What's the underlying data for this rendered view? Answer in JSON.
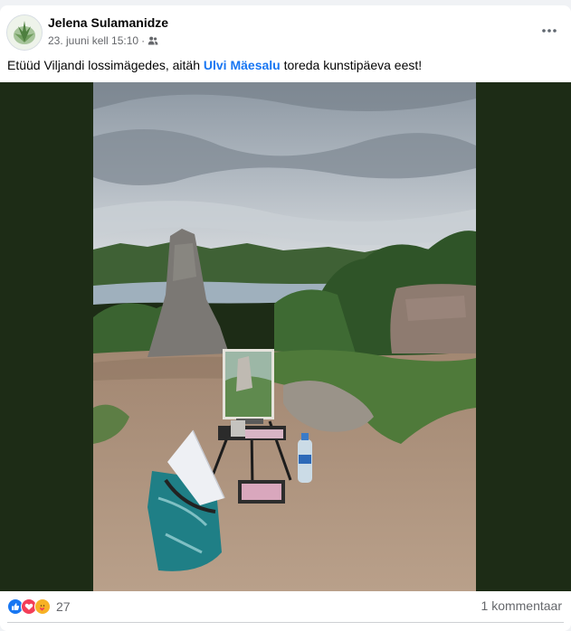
{
  "post": {
    "author": "Jelena Sulamanidze",
    "date": "23. juuni kell 15:10",
    "separator": "·",
    "audience_icon": "friends-icon",
    "caption_before": "Etüüd Viljandi lossimägedes, aitäh ",
    "caption_mention": "Ulvi Mäesalu",
    "caption_after": " toreda kunstipäeva eest!"
  },
  "footer": {
    "reactions": [
      "like-icon",
      "love-icon",
      "care-icon"
    ],
    "reaction_count": "27",
    "comments_label": "1 kommentaar"
  },
  "colors": {
    "link": "#1876f2",
    "like": "#1877f2",
    "love": "#f33e58",
    "care": "#f7b125",
    "media_background": "#1d2c16"
  }
}
